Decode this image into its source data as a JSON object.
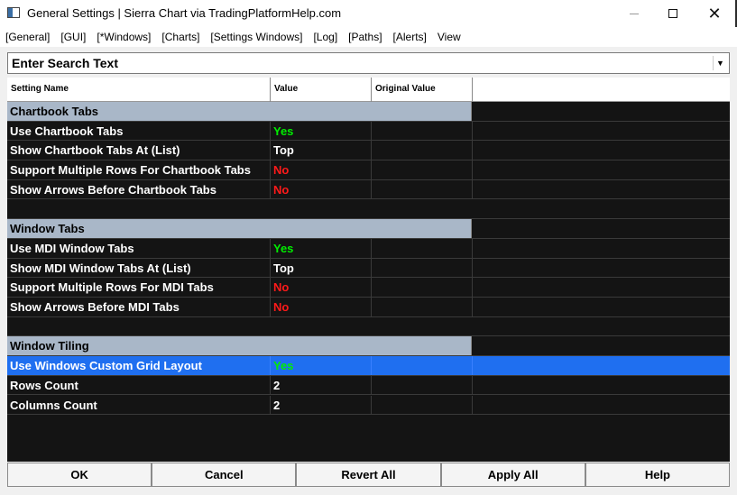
{
  "window": {
    "title": "General Settings | Sierra Chart via TradingPlatformHelp.com",
    "min_icon": "minimize-icon",
    "max_icon": "maximize-icon",
    "close_glyph": "✕"
  },
  "menu": [
    "[General]",
    "[GUI]",
    "[*Windows]",
    "[Charts]",
    "[Settings Windows]",
    "[Log]",
    "[Paths]",
    "[Alerts]",
    "View"
  ],
  "search": {
    "placeholder": "Enter Search Text",
    "value": "",
    "dropdown_glyph": "▼"
  },
  "grid": {
    "headers": {
      "name": "Setting Name",
      "value": "Value",
      "original": "Original Value"
    },
    "rows": [
      {
        "type": "group",
        "name": "Chartbook Tabs"
      },
      {
        "type": "setting",
        "name": "Use Chartbook Tabs",
        "value": "Yes",
        "kind": "yes",
        "original": ""
      },
      {
        "type": "setting",
        "name": "Show Chartbook Tabs At (List)",
        "value": "Top",
        "kind": "plain",
        "original": ""
      },
      {
        "type": "setting",
        "name": "Support Multiple Rows For Chartbook Tabs",
        "value": "No",
        "kind": "no",
        "original": ""
      },
      {
        "type": "setting",
        "name": "Show Arrows Before Chartbook Tabs",
        "value": "No",
        "kind": "no",
        "original": ""
      },
      {
        "type": "blank"
      },
      {
        "type": "group",
        "name": "Window Tabs"
      },
      {
        "type": "setting",
        "name": "Use MDI Window Tabs",
        "value": "Yes",
        "kind": "yes",
        "original": ""
      },
      {
        "type": "setting",
        "name": "Show MDI Window Tabs At (List)",
        "value": "Top",
        "kind": "plain",
        "original": ""
      },
      {
        "type": "setting",
        "name": "Support Multiple Rows For MDI Tabs",
        "value": "No",
        "kind": "no",
        "original": ""
      },
      {
        "type": "setting",
        "name": "Show Arrows Before MDI Tabs",
        "value": "No",
        "kind": "no",
        "original": ""
      },
      {
        "type": "blank"
      },
      {
        "type": "group",
        "name": "Window Tiling"
      },
      {
        "type": "setting",
        "name": "Use Windows Custom Grid Layout",
        "value": "Yes",
        "kind": "yes",
        "original": "",
        "selected": true
      },
      {
        "type": "setting",
        "name": "Rows Count",
        "value": "2",
        "kind": "plain",
        "original": ""
      },
      {
        "type": "setting",
        "name": "Columns Count",
        "value": "2",
        "kind": "plain",
        "original": ""
      }
    ]
  },
  "buttons": {
    "ok": "OK",
    "cancel": "Cancel",
    "revert": "Revert All",
    "apply": "Apply All",
    "help": "Help"
  },
  "colors": {
    "yes": "#00ee00",
    "no": "#ff1a1a",
    "group_bg": "#a9b7c8",
    "selected_bg": "#1f6ff0",
    "grid_bg": "#141414"
  }
}
